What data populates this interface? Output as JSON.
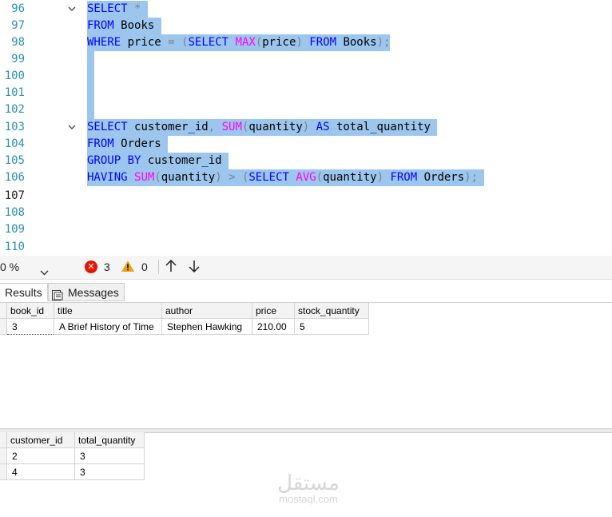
{
  "editor": {
    "lines": [
      {
        "num": "96"
      },
      {
        "num": "97"
      },
      {
        "num": "98"
      },
      {
        "num": "99"
      },
      {
        "num": "100"
      },
      {
        "num": "101"
      },
      {
        "num": "102"
      },
      {
        "num": "103"
      },
      {
        "num": "104"
      },
      {
        "num": "105"
      },
      {
        "num": "106"
      },
      {
        "num": "107"
      },
      {
        "num": "108"
      },
      {
        "num": "109"
      },
      {
        "num": "110"
      }
    ],
    "query1": {
      "l1": {
        "select": "SELECT",
        "star": "*"
      },
      "l2": {
        "from": "FROM",
        "table": "Books"
      },
      "l3": {
        "where": "WHERE",
        "col": "price",
        "eq": "=",
        "lp": "(",
        "select": "SELECT",
        "max": "MAX",
        "lp2": "(",
        "arg": "price",
        "rp2": ")",
        "from": "FROM",
        "table": "Books",
        "rp": ");"
      }
    },
    "query2": {
      "l1": {
        "select": "SELECT",
        "col": "customer_id",
        "comma": ",",
        "sum": "SUM",
        "lp": "(",
        "arg": "quantity",
        "rp": ")",
        "as": "AS",
        "alias": "total_quantity"
      },
      "l2": {
        "from": "FROM",
        "table": "Orders"
      },
      "l3": {
        "group": "GROUP",
        "by": "BY",
        "col": "customer_id"
      },
      "l4": {
        "having": "HAVING",
        "sum": "SUM",
        "lp": "(",
        "arg": "quantity",
        "rp": ")",
        "gt": ">",
        "lp2": "(",
        "select": "SELECT",
        "avg": "AVG",
        "lp3": "(",
        "arg2": "quantity",
        "rp3": ")",
        "from": "FROM",
        "table": "Orders",
        "rp2": ");"
      }
    }
  },
  "status": {
    "zoom": "0 %",
    "errors": "3",
    "warnings": "0"
  },
  "tabs": {
    "results": "Results",
    "messages": "Messages"
  },
  "grid1": {
    "headers": [
      "book_id",
      "title",
      "author",
      "price",
      "stock_quantity"
    ],
    "rows": [
      [
        "3",
        "A Brief History of Time",
        "Stephen Hawking",
        "210.00",
        "5"
      ]
    ]
  },
  "grid2": {
    "headers": [
      "customer_id",
      "total_quantity"
    ],
    "rows": [
      [
        "2",
        "3"
      ],
      [
        "4",
        "3"
      ]
    ]
  },
  "watermark": {
    "arabic": "مستقل",
    "latin": "mostaql.com"
  },
  "colors": {
    "selection": "#9dc6ee",
    "keyword": "#0000ff",
    "function": "#ff00ff",
    "operator": "#808080",
    "line_number": "#2b91af",
    "error": "#e51400",
    "warning": "#e8a317"
  }
}
